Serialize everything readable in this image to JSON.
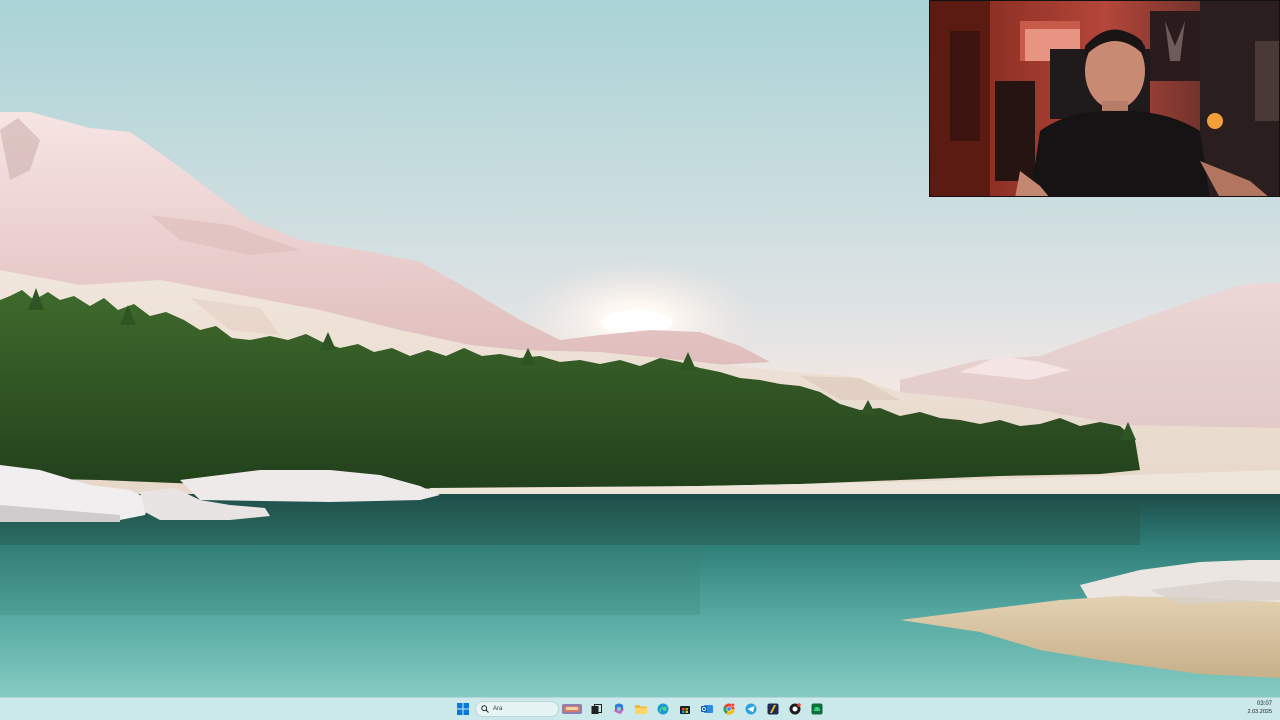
{
  "desktop": {
    "wallpaper": "windows-11-lake-landscape"
  },
  "webcam_overlay": {
    "content": "streamer-camera"
  },
  "taskbar": {
    "search": {
      "placeholder": "Ara",
      "icon": "search-icon"
    },
    "apps": [
      {
        "name": "start-button",
        "icon": "windows-logo-icon"
      },
      {
        "name": "news-widget",
        "icon": "weather-widget-icon"
      },
      {
        "name": "task-view",
        "icon": "task-view-icon"
      },
      {
        "name": "copilot",
        "icon": "copilot-icon"
      },
      {
        "name": "file-explorer",
        "icon": "folder-icon"
      },
      {
        "name": "edge",
        "icon": "edge-icon"
      },
      {
        "name": "microsoft-store",
        "icon": "store-icon"
      },
      {
        "name": "outlook",
        "icon": "mail-icon"
      },
      {
        "name": "chrome",
        "icon": "chrome-icon"
      },
      {
        "name": "telegram",
        "icon": "telegram-icon"
      },
      {
        "name": "app-yellow",
        "icon": "app-icon"
      },
      {
        "name": "obs",
        "icon": "record-icon"
      },
      {
        "name": "android-app",
        "icon": "android-icon"
      }
    ],
    "clock": {
      "time": "03:07",
      "date": "2.03.2025"
    },
    "colors": {
      "taskbar_bg": "#cbe9ea",
      "windows_blue": "#0a78d7"
    }
  }
}
